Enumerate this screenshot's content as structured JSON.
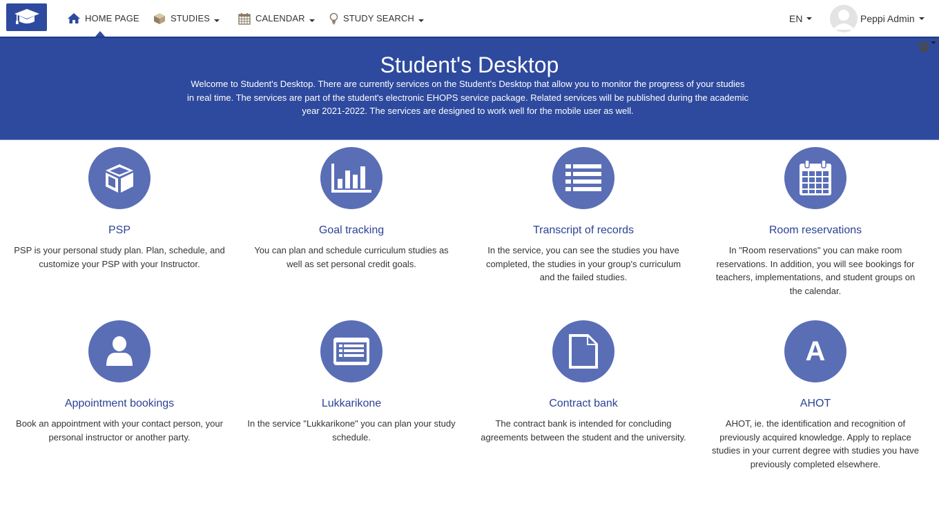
{
  "nav": {
    "home": "HOME PAGE",
    "studies": "STUDIES",
    "calendar": "CALENDAR",
    "study_search": "STUDY SEARCH",
    "language": "EN",
    "user_name": "Peppi Admin"
  },
  "banner": {
    "title": "Student's Desktop",
    "text": "Welcome to Student's Desktop. There are currently services on the Student's Desktop that allow you to monitor the progress of your studies in real time. The services are part of the student's electronic EHOPS service package. Related services will be published during the academic year 2021-2022. The services are designed to work well for the mobile user as well."
  },
  "services": [
    {
      "icon": "cube-icon",
      "title": "PSP",
      "desc": "PSP is your personal study plan. Plan, schedule, and customize your PSP with your Instructor."
    },
    {
      "icon": "bar-chart-icon",
      "title": "Goal tracking",
      "desc": "You can plan and schedule curriculum studies as well as set personal credit goals."
    },
    {
      "icon": "list-icon",
      "title": "Transcript of records",
      "desc": "In the service, you can see the studies you have completed, the studies in your group's curriculum and the failed studies."
    },
    {
      "icon": "calendar-icon",
      "title": "Room reservations",
      "desc": "In \"Room reservations\" you can make room reservations. In addition, you will see bookings for teachers, implementations, and student groups on the calendar."
    },
    {
      "icon": "user-icon",
      "title": "Appointment bookings",
      "desc": "Book an appointment with your contact person, your personal instructor or another party."
    },
    {
      "icon": "list-alt-icon",
      "title": "Lukkarikone",
      "desc": "In the service \"Lukkarikone\" you can plan your study schedule."
    },
    {
      "icon": "file-icon",
      "title": "Contract bank",
      "desc": "The contract bank is intended for concluding agreements between the student and the university."
    },
    {
      "icon": "letter-a-icon",
      "letter": "A",
      "title": "AHOT",
      "desc": "AHOT, ie. the identification and recognition of previously acquired knowledge. Apply to replace studies in your current degree with studies you have previously completed elsewhere."
    }
  ],
  "colors": {
    "brand": "#2e4a9e",
    "circle": "#5a6eb6",
    "link": "#2c4295"
  }
}
